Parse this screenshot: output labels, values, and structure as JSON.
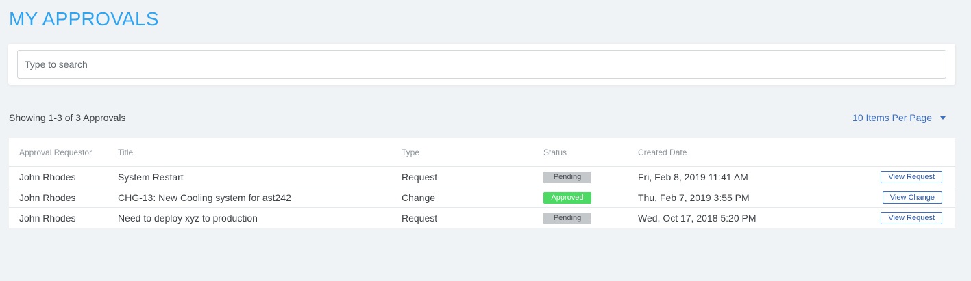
{
  "page": {
    "title": "MY APPROVALS"
  },
  "search": {
    "placeholder": "Type to search",
    "value": ""
  },
  "summary": {
    "showing_text": "Showing 1-3 of 3 Approvals",
    "per_page_label": "10 Items Per Page",
    "per_page_icon": "caret-down-icon"
  },
  "table": {
    "headers": [
      "Approval Requestor",
      "Title",
      "Type",
      "Status",
      "Created Date",
      ""
    ],
    "rows": [
      {
        "requestor": "John Rhodes",
        "title": "System Restart",
        "type": "Request",
        "status": "Pending",
        "created": "Fri, Feb 8, 2019 11:41 AM",
        "action": "View Request"
      },
      {
        "requestor": "John Rhodes",
        "title": "CHG-13: New Cooling system for ast242",
        "type": "Change",
        "status": "Approved",
        "created": "Thu, Feb 7, 2019 3:55 PM",
        "action": "View Change"
      },
      {
        "requestor": "John Rhodes",
        "title": "Need to deploy xyz to production",
        "type": "Request",
        "status": "Pending",
        "created": "Wed, Oct 17, 2018 5:20 PM",
        "action": "View Request"
      }
    ]
  },
  "colors": {
    "title": "#2ea3f2",
    "link": "#3b6fc4",
    "pending": "#c4c8cb",
    "approved": "#4cd964",
    "background": "#f0f3f5"
  }
}
